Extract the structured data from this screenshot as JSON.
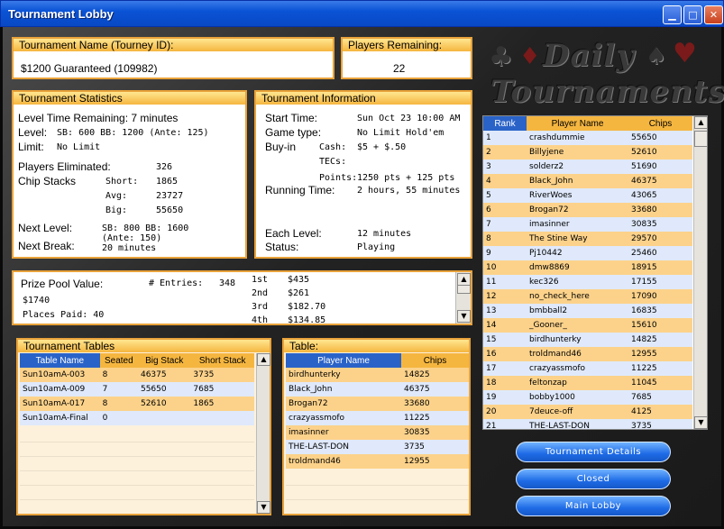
{
  "window": {
    "title": "Tournament Lobby",
    "minimize": "▁",
    "maximize": "□",
    "close": "✕"
  },
  "tourney": {
    "name_header": "Tournament Name (Tourney ID):",
    "name_value": "$1200 Guaranteed (109982)",
    "players_header": "Players Remaining:",
    "players_value": "22"
  },
  "stats": {
    "header": "Tournament Statistics",
    "level_time": "Level Time Remaining: 7 minutes",
    "level_label": "Level:",
    "level_value": "SB: 600  BB: 1200  (Ante: 125)",
    "limit_label": "Limit:",
    "limit_value": "No Limit",
    "eliminated_label": "Players Eliminated:",
    "eliminated_value": "326",
    "chip_stacks_label": "Chip Stacks",
    "short_label": "Short:",
    "short_value": "1865",
    "avg_label": "Avg:",
    "avg_value": "23727",
    "big_label": "Big:",
    "big_value": "55650",
    "next_level_label": "Next Level:",
    "next_level_value": "SB: 800  BB: 1600",
    "next_level_ante": "(Ante: 150)",
    "next_break_label": "Next Break:",
    "next_break_value": "20 minutes"
  },
  "info": {
    "header": "Tournament Information",
    "start_label": "Start Time:",
    "start_value": "Sun Oct 23 10:00 AM",
    "game_label": "Game type:",
    "game_value": "No Limit Hold'em",
    "buyin_label": "Buy-in",
    "cash_label": "Cash:",
    "cash_value": "$5 + $.50",
    "tecs_label": "TECs:",
    "tecs_value": "",
    "points_label": "Points:",
    "points_value": "1250 pts + 125 pts",
    "running_label": "Running Time:",
    "running_value": "2 hours, 55 minutes",
    "each_label": "Each Level:",
    "each_value": "12 minutes",
    "status_label": "Status:",
    "status_value": "Playing"
  },
  "prize": {
    "pool_label": "Prize Pool Value:",
    "pool_value": "$1740",
    "entries_label": "# Entries:",
    "entries_value": "348",
    "places_label": "Places Paid: 40",
    "payouts": [
      {
        "place": "1st",
        "amount": "$435"
      },
      {
        "place": "2nd",
        "amount": "$261"
      },
      {
        "place": "3rd",
        "amount": "$182.70"
      },
      {
        "place": "4th",
        "amount": "$134.85"
      }
    ]
  },
  "tables": {
    "header": "Tournament Tables",
    "columns": [
      "Table Name",
      "Seated",
      "Big Stack",
      "Short Stack"
    ],
    "rows": [
      [
        "Sun10amA-003",
        "8",
        "46375",
        "3735"
      ],
      [
        "Sun10amA-009",
        "7",
        "55650",
        "7685"
      ],
      [
        "Sun10amA-017",
        "8",
        "52610",
        "1865"
      ],
      [
        "Sun10amA-Final",
        "0",
        "",
        ""
      ]
    ]
  },
  "table": {
    "header": "Table:",
    "columns": [
      "Player Name",
      "Chips"
    ],
    "rows": [
      [
        "birdhunterky",
        "14825"
      ],
      [
        "Black_John",
        "46375"
      ],
      [
        "Brogan72",
        "33680"
      ],
      [
        "crazyassmofo",
        "11225"
      ],
      [
        "imasinner",
        "30835"
      ],
      [
        "THE-LAST-DON",
        "3735"
      ],
      [
        "troldmand46",
        "12955"
      ]
    ]
  },
  "ranking": {
    "columns": [
      "Rank",
      "Player Name",
      "Chips"
    ],
    "rows": [
      [
        "1",
        "crashdummie",
        "55650"
      ],
      [
        "2",
        "Billyjene",
        "52610"
      ],
      [
        "3",
        "solderz2",
        "51690"
      ],
      [
        "4",
        "Black_John",
        "46375"
      ],
      [
        "5",
        "RiverWoes",
        "43065"
      ],
      [
        "6",
        "Brogan72",
        "33680"
      ],
      [
        "7",
        "imasinner",
        "30835"
      ],
      [
        "8",
        "The Stine Way",
        "29570"
      ],
      [
        "9",
        "Pj10442",
        "25460"
      ],
      [
        "10",
        "dmw8869",
        "18915"
      ],
      [
        "11",
        "kec326",
        "17155"
      ],
      [
        "12",
        "no_check_here",
        "17090"
      ],
      [
        "13",
        "bmbball2",
        "16835"
      ],
      [
        "14",
        "_Gooner_",
        "15610"
      ],
      [
        "15",
        "birdhunterky",
        "14825"
      ],
      [
        "16",
        "troldmand46",
        "12955"
      ],
      [
        "17",
        "crazyassmofo",
        "11225"
      ],
      [
        "18",
        "feltonzap",
        "11045"
      ],
      [
        "19",
        "bobby1000",
        "7685"
      ],
      [
        "20",
        "7deuce-off",
        "4125"
      ],
      [
        "21",
        "THE-LAST-DON",
        "3735"
      ]
    ]
  },
  "logo": {
    "line1": "Daily",
    "line2": "Tournaments"
  },
  "buttons": {
    "details": "Tournament Details",
    "closed": "Closed",
    "main_lobby": "Main Lobby"
  },
  "colors": {
    "accent": "#f5b640",
    "blue_row": "#dfe9fb",
    "orange_row": "#fcd28a",
    "title_blue": "#0a53d6"
  }
}
